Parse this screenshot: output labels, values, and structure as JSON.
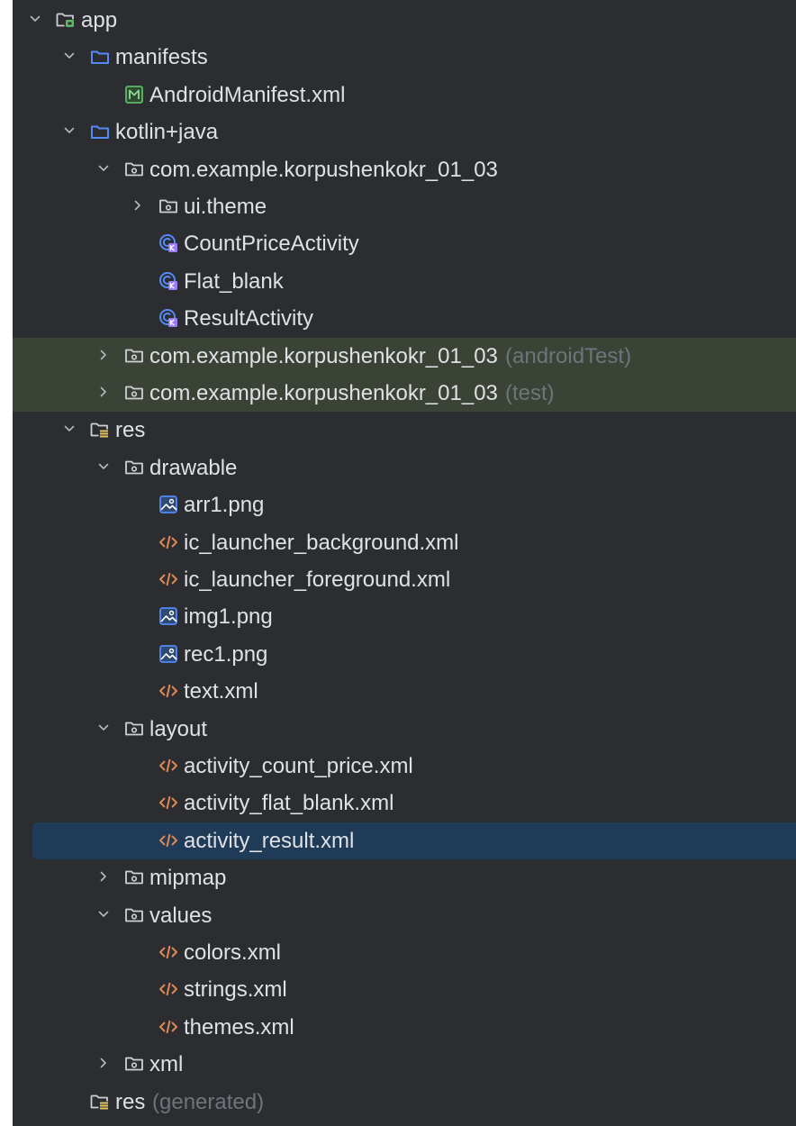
{
  "tree": {
    "items": [
      {
        "label": "app",
        "suffix": "",
        "icon": "module-folder-icon",
        "depth": 0,
        "chevron": "down",
        "state": ""
      },
      {
        "label": "manifests",
        "suffix": "",
        "icon": "folder-icon",
        "depth": 1,
        "chevron": "down",
        "state": ""
      },
      {
        "label": "AndroidManifest.xml",
        "suffix": "",
        "icon": "manifest-file-icon",
        "depth": 2,
        "chevron": "",
        "state": ""
      },
      {
        "label": "kotlin+java",
        "suffix": "",
        "icon": "folder-icon",
        "depth": 1,
        "chevron": "down",
        "state": ""
      },
      {
        "label": "com.example.korpushenkokr_01_03",
        "suffix": "",
        "icon": "package-icon",
        "depth": 2,
        "chevron": "down",
        "state": ""
      },
      {
        "label": "ui.theme",
        "suffix": "",
        "icon": "package-icon",
        "depth": 3,
        "chevron": "right",
        "state": ""
      },
      {
        "label": "CountPriceActivity",
        "suffix": "",
        "icon": "kotlin-class-icon",
        "depth": 3,
        "chevron": "",
        "state": ""
      },
      {
        "label": "Flat_blank",
        "suffix": "",
        "icon": "kotlin-class-icon",
        "depth": 3,
        "chevron": "",
        "state": ""
      },
      {
        "label": "ResultActivity",
        "suffix": "",
        "icon": "kotlin-class-icon",
        "depth": 3,
        "chevron": "",
        "state": ""
      },
      {
        "label": "com.example.korpushenkokr_01_03",
        "suffix": "(androidTest)",
        "icon": "package-icon",
        "depth": 2,
        "chevron": "right",
        "state": "hl-green"
      },
      {
        "label": "com.example.korpushenkokr_01_03",
        "suffix": "(test)",
        "icon": "package-icon",
        "depth": 2,
        "chevron": "right",
        "state": "hl-green"
      },
      {
        "label": "res",
        "suffix": "",
        "icon": "resources-folder-icon",
        "depth": 1,
        "chevron": "down",
        "state": ""
      },
      {
        "label": "drawable",
        "suffix": "",
        "icon": "package-icon",
        "depth": 2,
        "chevron": "down",
        "state": ""
      },
      {
        "label": "arr1.png",
        "suffix": "",
        "icon": "image-file-icon",
        "depth": 3,
        "chevron": "",
        "state": ""
      },
      {
        "label": "ic_launcher_background.xml",
        "suffix": "",
        "icon": "xml-file-icon",
        "depth": 3,
        "chevron": "",
        "state": ""
      },
      {
        "label": "ic_launcher_foreground.xml",
        "suffix": "",
        "icon": "xml-file-icon",
        "depth": 3,
        "chevron": "",
        "state": ""
      },
      {
        "label": "img1.png",
        "suffix": "",
        "icon": "image-file-icon",
        "depth": 3,
        "chevron": "",
        "state": ""
      },
      {
        "label": "rec1.png",
        "suffix": "",
        "icon": "image-file-icon",
        "depth": 3,
        "chevron": "",
        "state": ""
      },
      {
        "label": "text.xml",
        "suffix": "",
        "icon": "xml-file-icon",
        "depth": 3,
        "chevron": "",
        "state": ""
      },
      {
        "label": "layout",
        "suffix": "",
        "icon": "package-icon",
        "depth": 2,
        "chevron": "down",
        "state": ""
      },
      {
        "label": "activity_count_price.xml",
        "suffix": "",
        "icon": "xml-file-icon",
        "depth": 3,
        "chevron": "",
        "state": ""
      },
      {
        "label": "activity_flat_blank.xml",
        "suffix": "",
        "icon": "xml-file-icon",
        "depth": 3,
        "chevron": "",
        "state": ""
      },
      {
        "label": "activity_result.xml",
        "suffix": "",
        "icon": "xml-file-icon",
        "depth": 3,
        "chevron": "",
        "state": "selected"
      },
      {
        "label": "mipmap",
        "suffix": "",
        "icon": "package-icon",
        "depth": 2,
        "chevron": "right",
        "state": ""
      },
      {
        "label": "values",
        "suffix": "",
        "icon": "package-icon",
        "depth": 2,
        "chevron": "down",
        "state": ""
      },
      {
        "label": "colors.xml",
        "suffix": "",
        "icon": "xml-file-icon",
        "depth": 3,
        "chevron": "",
        "state": ""
      },
      {
        "label": "strings.xml",
        "suffix": "",
        "icon": "xml-file-icon",
        "depth": 3,
        "chevron": "",
        "state": ""
      },
      {
        "label": "themes.xml",
        "suffix": "",
        "icon": "xml-file-icon",
        "depth": 3,
        "chevron": "",
        "state": ""
      },
      {
        "label": "xml",
        "suffix": "",
        "icon": "package-icon",
        "depth": 2,
        "chevron": "right",
        "state": ""
      },
      {
        "label": "res",
        "suffix": "(generated)",
        "icon": "resources-folder-icon",
        "depth": 1,
        "chevron": "",
        "state": ""
      }
    ]
  },
  "colors": {
    "background": "#2b2d30",
    "text": "#dfe1e5",
    "muted_text": "#6f737a",
    "test_highlight": "#3b4337",
    "selection": "#1f3b57",
    "folder_blue": "#548af7",
    "xml_orange": "#e08855",
    "kotlin_purple": "#9b7cf5",
    "manifest_green": "#5fb865"
  }
}
